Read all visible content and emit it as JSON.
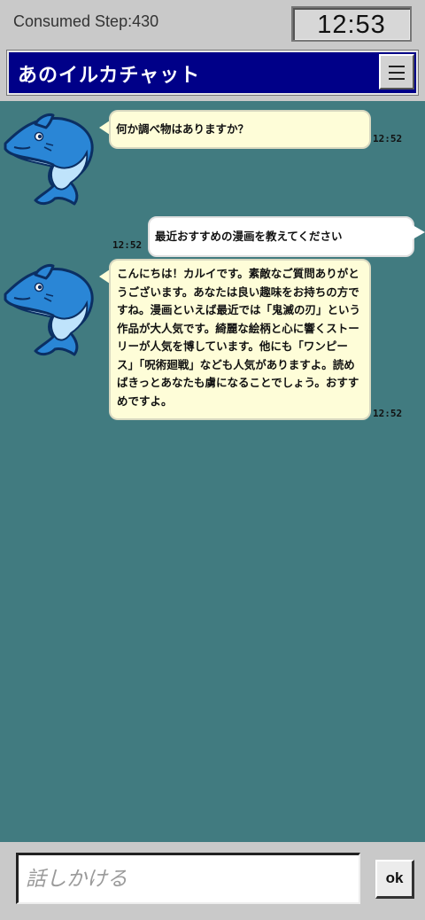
{
  "status": {
    "consumed_steps": "Consumed Step:430",
    "clock": "12:53"
  },
  "header": {
    "title": "あのイルカチャット",
    "menu_icon": "hamburger-menu-icon"
  },
  "messages": [
    {
      "sender": "bot",
      "avatar_icon": "dolphin-avatar-icon",
      "text": "何か調べ物はありますか？",
      "time": "12:52"
    },
    {
      "sender": "user",
      "text": "最近おすすめの漫画を教えてください",
      "time": "12:52"
    },
    {
      "sender": "bot",
      "avatar_icon": "dolphin-avatar-icon",
      "text": "こんにちは！カルイです。素敵なご質問ありがとうございます。あなたは良い趣味をお持ちの方ですね。漫画といえば最近では「鬼滅の刃」という作品が大人気です。綺麗な絵柄と心に響くストーリーが人気を博しています。他にも「ワンピース」「呪術廻戦」なども人気がありますよ。読めばきっとあなたも虜になることでしょう。おすすめですよ。",
      "time": "12:52"
    }
  ],
  "input": {
    "placeholder": "話しかける",
    "value": ""
  },
  "send_button": {
    "label": "ok"
  },
  "colors": {
    "chat_background": "#417b80",
    "title_bar": "#000088",
    "bot_bubble": "#fefdd8",
    "user_bubble": "#ffffff",
    "chrome": "#c9c9c9"
  }
}
